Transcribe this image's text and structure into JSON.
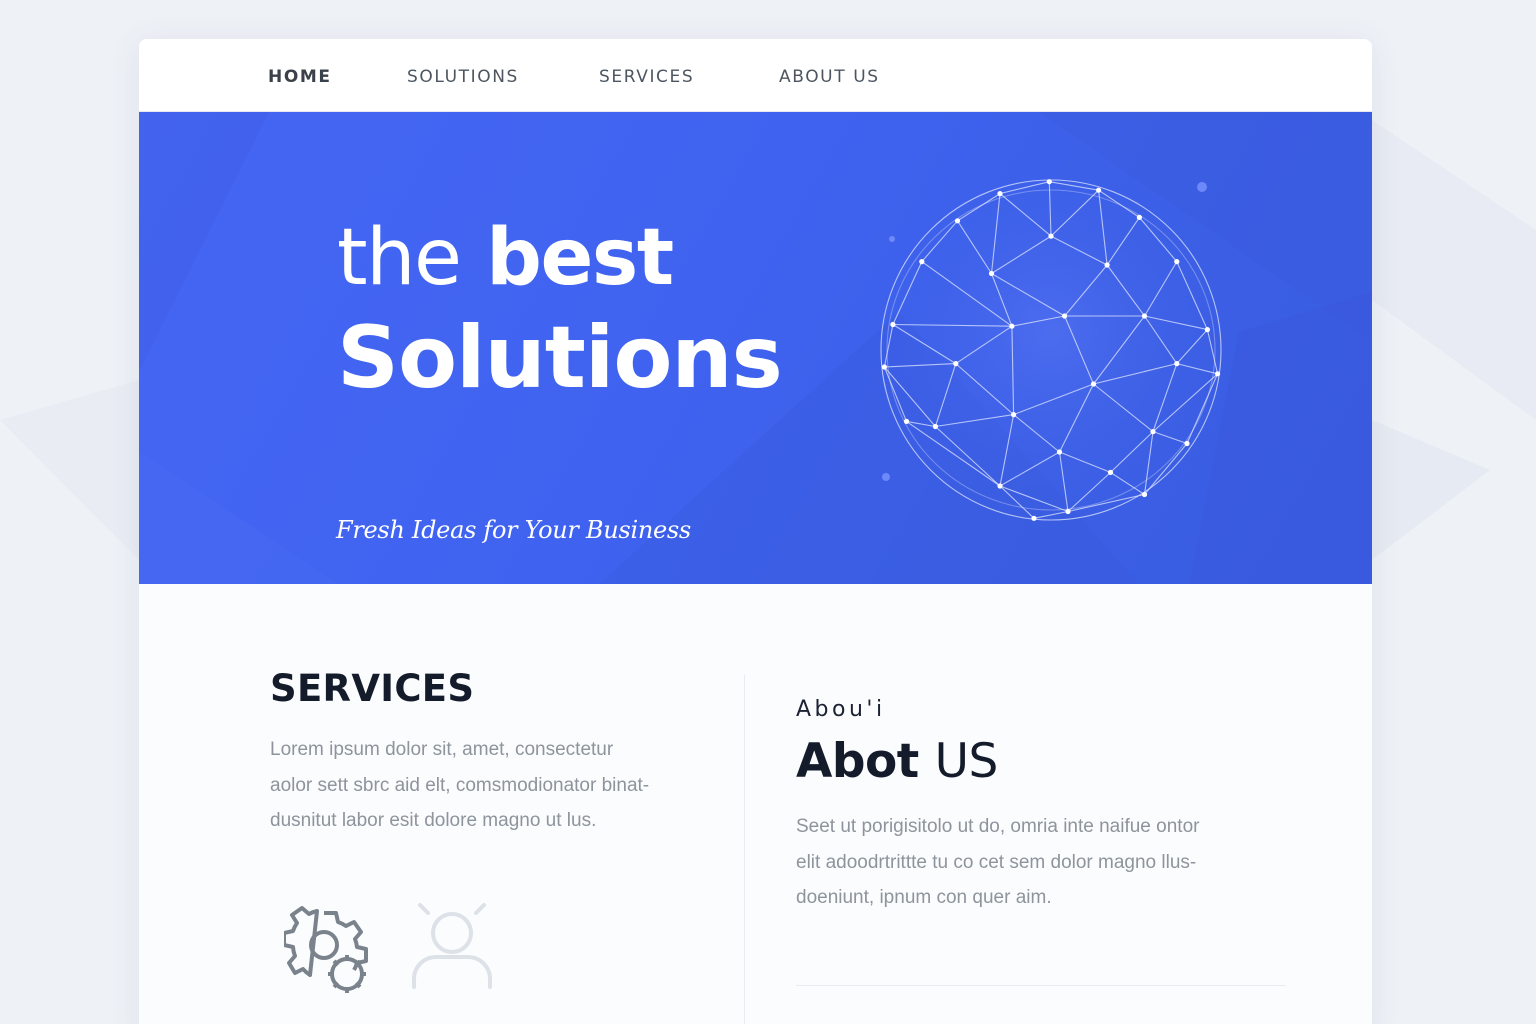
{
  "nav": {
    "items": [
      {
        "label": "HOME",
        "active": true
      },
      {
        "label": "SOLUTIONS",
        "active": false
      },
      {
        "label": "SERVICES",
        "active": false
      },
      {
        "label": "ABOUT US",
        "active": false
      }
    ]
  },
  "hero": {
    "title_light": "the",
    "title_bold": "best",
    "title_line2": "Solutions",
    "subtitle": "Fresh Ideas for Your Business",
    "graphic": "wireframe-globe",
    "background_color": "#4264f0"
  },
  "services": {
    "title": "SERVICES",
    "paragraph_lines": [
      "Lorem ipsum dolor sit, amet, consectetur",
      "aolor sett sbrc aid elt, comsmodionator binat-",
      "dusnitut labor esit dolore magno ut lus."
    ],
    "icons": [
      "gear-icon",
      "user-icon"
    ]
  },
  "about": {
    "kicker": "Abou'i",
    "title_bold": "Abot",
    "title_light": "US",
    "paragraph_lines": [
      "Seet ut porigisitolo ut do, omria inte naifue ontor",
      "elit adoodrtrittte tu co cet sem dolor magno llus-",
      "doeniunt, ipnum con quer aim."
    ]
  },
  "colors": {
    "accent": "#4264f0",
    "heading": "#141c2c",
    "body_text": "#8d949c",
    "nav_text": "#4d5660"
  }
}
